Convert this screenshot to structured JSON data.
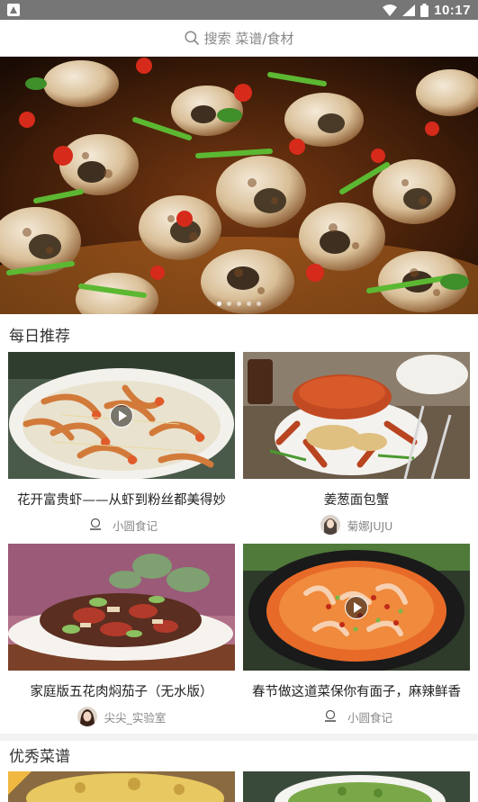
{
  "status_bar": {
    "time": "10:17"
  },
  "search": {
    "placeholder": "搜索 菜谱/食材"
  },
  "banner": {
    "slide_count": 5,
    "active_index": 0
  },
  "daily": {
    "title": "每日推荐",
    "cards": [
      {
        "title": "花开富贵虾——从虾到粉丝都美得妙",
        "author": "小圆食记",
        "video": true
      },
      {
        "title": "姜葱面包蟹",
        "author": "菊娜JUJU",
        "video": false
      },
      {
        "title": "家庭版五花肉焖茄子（无水版）",
        "author": "尖尖_实验室",
        "video": false
      },
      {
        "title": "春节做这道菜保你有面子，麻辣鲜香",
        "author": "小圆食记",
        "video": true
      }
    ]
  },
  "excellent": {
    "title": "优秀菜谱"
  },
  "colors": {
    "status_bar": "#767676",
    "background": "#ffffff",
    "muted_text": "#888888"
  }
}
